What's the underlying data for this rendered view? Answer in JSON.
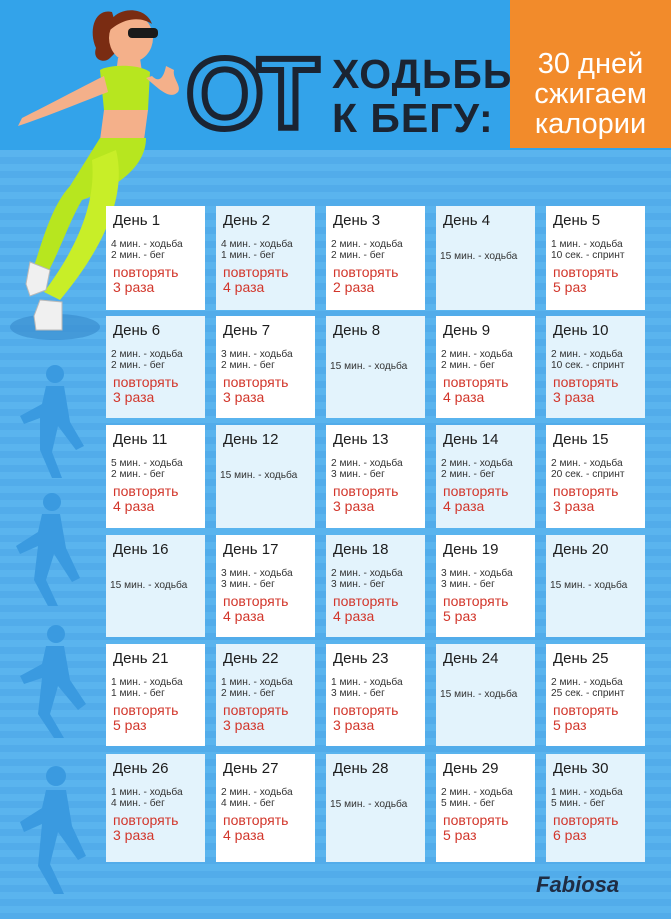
{
  "header": {
    "title_ot": "ОТ",
    "title_line1": "ХОДЬБЫ",
    "title_line2": "К БЕГУ:",
    "badge": [
      "30 дней",
      "сжигаем",
      "калории"
    ]
  },
  "brand": "Fabiosa",
  "colors": {
    "background": "#5ab4ee",
    "header": "#33a3ea",
    "badge": "#f28b2b",
    "repeat_text": "#d2362b"
  },
  "days": [
    {
      "day": "День 1",
      "lines": [
        "4 мин. - ходьба",
        "2 мин. - бег"
      ],
      "repeat": "повторять",
      "times": "3 раза"
    },
    {
      "day": "День 2",
      "lines": [
        "4 мин. - ходьба",
        "1 мин. - бег"
      ],
      "repeat": "повторять",
      "times": "4 раза"
    },
    {
      "day": "День 3",
      "lines": [
        "2 мин. - ходьба",
        "2 мин. - бег"
      ],
      "repeat": "повторять",
      "times": "2 раза"
    },
    {
      "day": "День 4",
      "single": "15 мин. - ходьба"
    },
    {
      "day": "День 5",
      "lines": [
        "1 мин. - ходьба",
        "10 сек. - спринт"
      ],
      "repeat": "повторять",
      "times": "5 раз"
    },
    {
      "day": "День 6",
      "lines": [
        "2 мин. - ходьба",
        "2 мин. - бег"
      ],
      "repeat": "повторять",
      "times": "3 раза"
    },
    {
      "day": "День 7",
      "lines": [
        "3 мин. - ходьба",
        "2 мин. - бег"
      ],
      "repeat": "повторять",
      "times": "3 раза"
    },
    {
      "day": "День 8",
      "single": "15 мин. - ходьба"
    },
    {
      "day": "День 9",
      "lines": [
        "2 мин. - ходьба",
        "2 мин. - бег"
      ],
      "repeat": "повторять",
      "times": "4 раза"
    },
    {
      "day": "День 10",
      "lines": [
        "2 мин. - ходьба",
        "10 сек. - спринт"
      ],
      "repeat": "повторять",
      "times": "3 раза"
    },
    {
      "day": "День 11",
      "lines": [
        "5 мин. - ходьба",
        "2 мин. - бег"
      ],
      "repeat": "повторять",
      "times": "4 раза"
    },
    {
      "day": "День 12",
      "single": "15 мин. - ходьба"
    },
    {
      "day": "День 13",
      "lines": [
        "2 мин. - ходьба",
        "3 мин. - бег"
      ],
      "repeat": "повторять",
      "times": "3 раза"
    },
    {
      "day": "День 14",
      "lines": [
        "2 мин. - ходьба",
        "2 мин. - бег"
      ],
      "repeat": "повторять",
      "times": "4 раза"
    },
    {
      "day": "День 15",
      "lines": [
        "2 мин. - ходьба",
        "20 сек. - спринт"
      ],
      "repeat": "повторять",
      "times": "3 раза"
    },
    {
      "day": "День 16",
      "single": "15 мин. - ходьба"
    },
    {
      "day": "День 17",
      "lines": [
        "3 мин. - ходьба",
        "3 мин. - бег"
      ],
      "repeat": "повторять",
      "times": "4 раза"
    },
    {
      "day": "День 18",
      "lines": [
        "2 мин. - ходьба",
        "3 мин. - бег"
      ],
      "repeat": "повторять",
      "times": "4 раза"
    },
    {
      "day": "День 19",
      "lines": [
        "3 мин. - ходьба",
        "3 мин. - бег"
      ],
      "repeat": "повторять",
      "times": "5 раз"
    },
    {
      "day": "День 20",
      "single": "15 мин. - ходьба"
    },
    {
      "day": "День 21",
      "lines": [
        "1 мин. - ходьба",
        "1 мин. - бег"
      ],
      "repeat": "повторять",
      "times": "5 раз"
    },
    {
      "day": "День 22",
      "lines": [
        "1 мин. - ходьба",
        "2 мин. - бег"
      ],
      "repeat": "повторять",
      "times": "3 раза"
    },
    {
      "day": "День 23",
      "lines": [
        "1 мин. - ходьба",
        "3 мин. - бег"
      ],
      "repeat": "повторять",
      "times": "3 раза"
    },
    {
      "day": "День 24",
      "single": "15 мин. - ходьба"
    },
    {
      "day": "День 25",
      "lines": [
        "2 мин. - ходьба",
        "25 сек. - спринт"
      ],
      "repeat": "повторять",
      "times": "5 раз"
    },
    {
      "day": "День 26",
      "lines": [
        "1 мин. - ходьба",
        "4 мин. - бег"
      ],
      "repeat": "повторять",
      "times": "3 раза"
    },
    {
      "day": "День 27",
      "lines": [
        "2 мин. - ходьба",
        "4 мин. - бег"
      ],
      "repeat": "повторять",
      "times": "4 раза"
    },
    {
      "day": "День 28",
      "single": "15 мин. - ходьба"
    },
    {
      "day": "День 29",
      "lines": [
        "2 мин. - ходьба",
        "5 мин. - бег"
      ],
      "repeat": "повторять",
      "times": "5 раз"
    },
    {
      "day": "День 30",
      "lines": [
        "1 мин. - ходьба",
        "5 мин. - бег"
      ],
      "repeat": "повторять",
      "times": "6 раз"
    }
  ]
}
